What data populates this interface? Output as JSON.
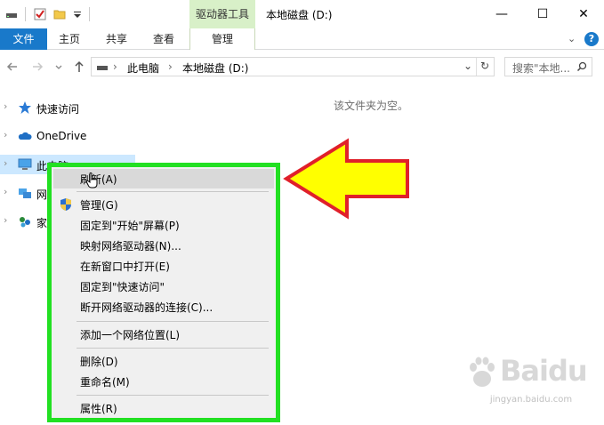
{
  "window": {
    "context_tab_group": "驱动器工具",
    "title": "本地磁盘 (D:)",
    "minimize": "—",
    "maximize": "☐",
    "close": "✕"
  },
  "ribbon": {
    "tabs": [
      "文件",
      "主页",
      "共享",
      "查看",
      "管理"
    ],
    "expand": "⌄",
    "help": "?"
  },
  "address_bar": {
    "breadcrumb": [
      "此电脑",
      "本地磁盘 (D:)"
    ],
    "separator": "›",
    "dropdown": "⌄",
    "refresh": "↻",
    "search_placeholder": "搜索\"本地...",
    "search_icon": "⌕"
  },
  "nav_pane": {
    "items": [
      {
        "label": "快速访问",
        "icon": "star-icon",
        "selected": false
      },
      {
        "label": "OneDrive",
        "icon": "cloud-icon",
        "selected": false
      },
      {
        "label": "此电脑",
        "icon": "pc-icon",
        "selected": true
      },
      {
        "label": "网",
        "icon": "network-icon",
        "selected": false
      },
      {
        "label": "家",
        "icon": "homegroup-icon",
        "selected": false
      }
    ]
  },
  "content": {
    "empty_message": "该文件夹为空。"
  },
  "context_menu": {
    "items": [
      {
        "label": "刷新(A)",
        "highlighted": true
      },
      {
        "label": "管理(G)",
        "icon": "shield-icon"
      },
      {
        "label": "固定到\"开始\"屏幕(P)"
      },
      {
        "label": "映射网络驱动器(N)..."
      },
      {
        "label": "在新窗口中打开(E)"
      },
      {
        "label": "固定到\"快速访问\""
      },
      {
        "label": "断开网络驱动器的连接(C)..."
      },
      {
        "label": "添加一个网络位置(L)"
      },
      {
        "label": "删除(D)"
      },
      {
        "label": "重命名(M)"
      },
      {
        "label": "属性(R)"
      }
    ]
  },
  "watermark": {
    "brand": "Baidu",
    "sub": "jingyan.baidu.com"
  },
  "colors": {
    "accent": "#1979ca",
    "context_tab": "#d8f0c8",
    "highlight_border": "#22e022",
    "arrow_fill": "#ffff00",
    "arrow_stroke": "#e0202a",
    "nav_selected": "#cce8ff"
  }
}
